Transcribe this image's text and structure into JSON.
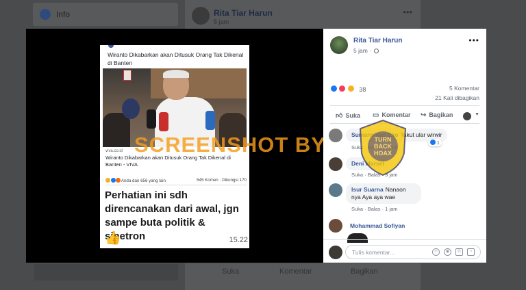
{
  "background": {
    "left_item": "Info",
    "post_author": "Rita Tiar Harun",
    "post_time": "5 jam",
    "actions": {
      "like": "Suka",
      "comment": "Komentar",
      "share": "Bagikan"
    }
  },
  "screenshot": {
    "title": "Wiranto Dikabarkan akan Ditusuk Orang Tak Dikenal di Banten",
    "source": "viva.co.id",
    "headline": "Wiranto Dikabarkan akan Ditusuk Orang Tak Dikenal di Banten - VIVA",
    "reaction_text": "Anda dan 656 yang lain",
    "stats": "545 Komen · Dikongsi 170",
    "caption": "Perhatian ini sdh direncanakan dari awal,  jgn sampe buta politik & sinetron",
    "time": "15.22"
  },
  "watermark": {
    "text": "SCREENSHOT BY",
    "badge_words": [
      "TURN",
      "BACK",
      "HOAX"
    ]
  },
  "post": {
    "author": "Rita Tiar Harun",
    "time": "5 jam",
    "reaction_count": "38",
    "comment_count": "5 Komentar",
    "share_count": "21 Kali dibagikan",
    "actions": {
      "like": "Suka",
      "comment": "Komentar",
      "share": "Bagikan"
    },
    "comments": [
      {
        "author": "Sumarwinad Eko",
        "text": "Takut ular wirwir",
        "meta": "Suka · Balas · 3 jam",
        "likes": "1"
      },
      {
        "author": "Deni Marsel",
        "text": "",
        "meta": "Suka · Balas · 3 jam"
      },
      {
        "author": "Isur Suarna",
        "text": "Nanaon nya Aya aya wae",
        "meta": "Suka · Balas · 1 jam"
      },
      {
        "author": "Mohammad Sofiyan",
        "text": "",
        "meta": ""
      }
    ],
    "compose_placeholder": "Tulis komentar..."
  },
  "colors": {
    "link_blue": "#385898",
    "fb_blue": "#1877f2",
    "watermark_orange": "#f49c1c",
    "badge_yellow": "#f5c400"
  }
}
